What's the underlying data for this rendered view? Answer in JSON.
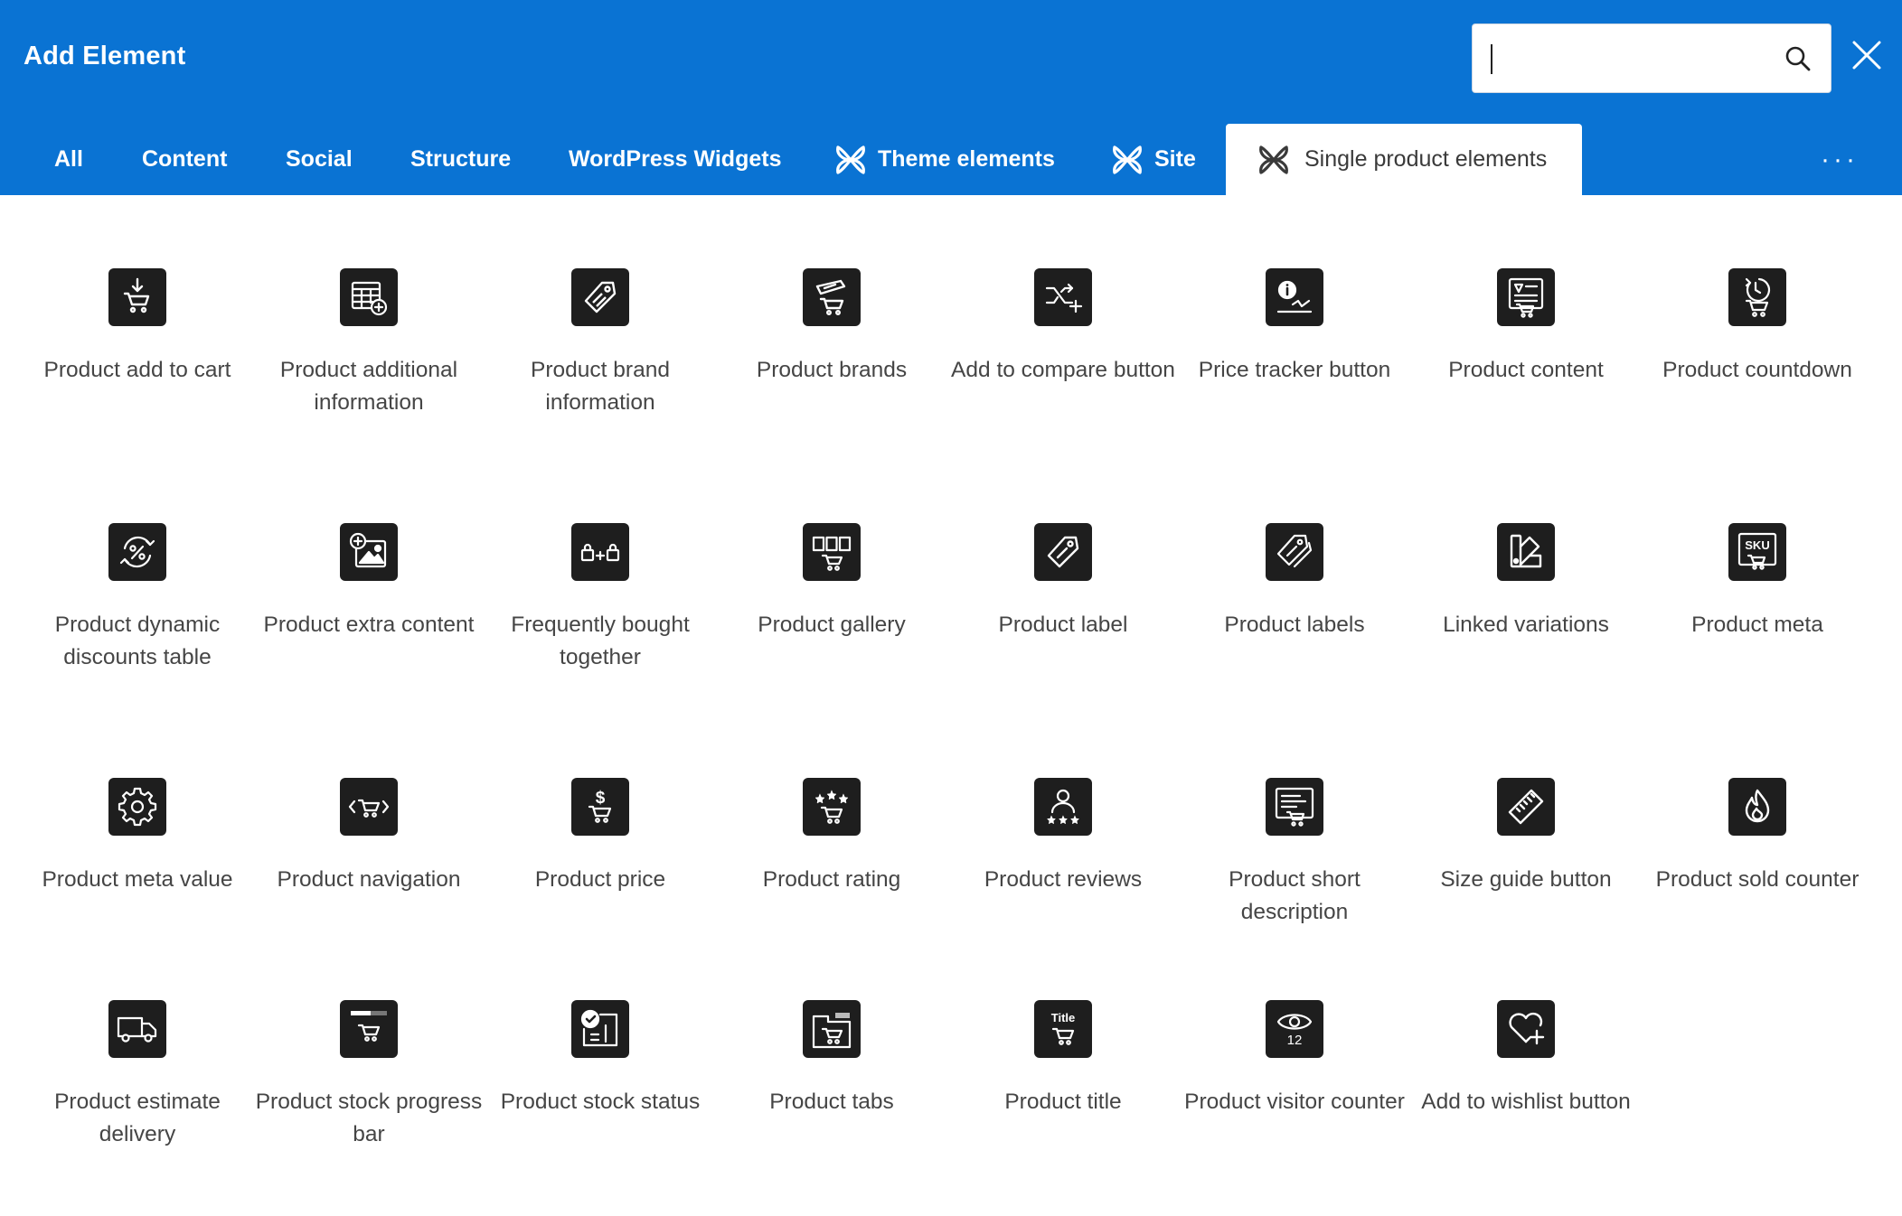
{
  "dialog": {
    "title": "Add Element",
    "search": {
      "value": "",
      "placeholder": ""
    }
  },
  "tabs": [
    {
      "label": "All"
    },
    {
      "label": "Content"
    },
    {
      "label": "Social"
    },
    {
      "label": "Structure"
    },
    {
      "label": "WordPress Widgets"
    },
    {
      "label": "Theme elements",
      "icon": "theme-builder-icon"
    },
    {
      "label": "Site",
      "icon": "theme-builder-icon"
    },
    {
      "label": "Single product elements",
      "icon": "theme-builder-icon",
      "active": true
    }
  ],
  "more": {
    "label": "···"
  },
  "elements": [
    {
      "label": "Product add to cart",
      "icon": "cart-download-icon"
    },
    {
      "label": "Product additional information",
      "icon": "table-plus-icon"
    },
    {
      "label": "Product brand information",
      "icon": "tag-icon"
    },
    {
      "label": "Product brands",
      "icon": "tag-cart-icon"
    },
    {
      "label": "Add to compare button",
      "icon": "shuffle-plus-icon"
    },
    {
      "label": "Price tracker button",
      "icon": "info-chart-icon"
    },
    {
      "label": "Product content",
      "icon": "content-cart-icon"
    },
    {
      "label": "Product countdown",
      "icon": "timer-cart-icon"
    },
    {
      "label": "Product dynamic discounts table",
      "icon": "percent-cycle-icon"
    },
    {
      "label": "Product extra content",
      "icon": "image-plus-icon"
    },
    {
      "label": "Frequently bought together",
      "icon": "bag-plus-bag-icon"
    },
    {
      "label": "Product gallery",
      "icon": "gallery-cart-icon"
    },
    {
      "label": "Product label",
      "icon": "label-icon"
    },
    {
      "label": "Product labels",
      "icon": "labels-icon"
    },
    {
      "label": "Linked variations",
      "icon": "swatch-icon"
    },
    {
      "label": "Product meta",
      "icon": "sku-cart-icon"
    },
    {
      "label": "Product meta value",
      "icon": "gear-icon"
    },
    {
      "label": "Product navigation",
      "icon": "cart-arrows-icon"
    },
    {
      "label": "Product price",
      "icon": "dollar-cart-icon"
    },
    {
      "label": "Product rating",
      "icon": "stars-cart-icon"
    },
    {
      "label": "Product reviews",
      "icon": "user-stars-icon"
    },
    {
      "label": "Product short description",
      "icon": "description-cart-icon"
    },
    {
      "label": "Size guide button",
      "icon": "ruler-icon"
    },
    {
      "label": "Product sold counter",
      "icon": "flame-icon"
    },
    {
      "label": "Product estimate delivery",
      "icon": "truck-icon"
    },
    {
      "label": "Product stock progress bar",
      "icon": "progress-cart-icon"
    },
    {
      "label": "Product stock status",
      "icon": "check-box-icon"
    },
    {
      "label": "Product tabs",
      "icon": "tabs-cart-icon"
    },
    {
      "label": "Product title",
      "icon": "title-cart-icon",
      "icon_text": "Title"
    },
    {
      "label": "Product visitor counter",
      "icon": "eye-counter-icon",
      "icon_text": "12"
    },
    {
      "label": "Add to wishlist button",
      "icon": "heart-plus-icon"
    }
  ]
}
